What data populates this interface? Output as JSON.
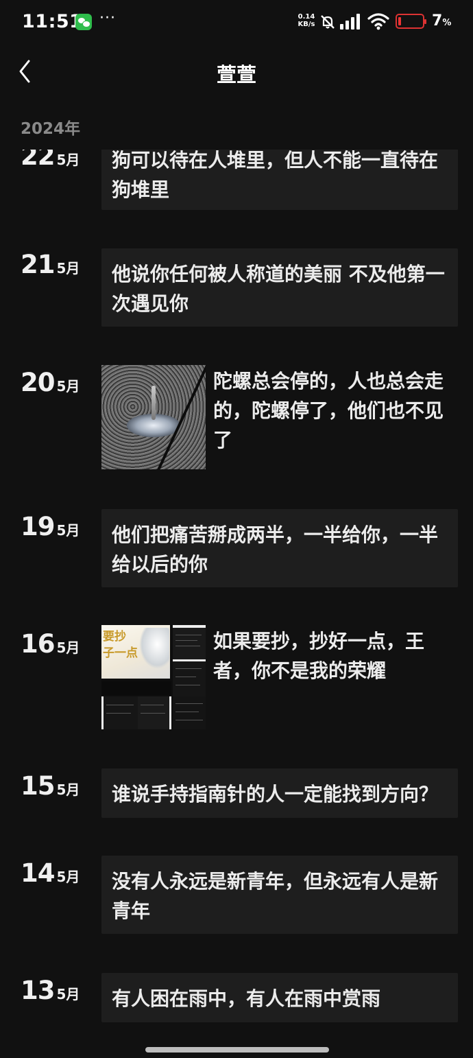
{
  "status_bar": {
    "time": "11:51",
    "dots": "···",
    "speed_value": "0.14",
    "speed_unit": "KB/s",
    "battery_pct": "7",
    "battery_unit": "%",
    "battery_color": "#dd3333",
    "wechat_color": "#2fbd4c"
  },
  "nav": {
    "title": "萱萱"
  },
  "year_header": "2024年",
  "entries": [
    {
      "day": "22",
      "month": "5月",
      "text": "狗可以待在人堆里，但人不能一直待在狗堆里"
    },
    {
      "day": "21",
      "month": "5月",
      "text": "他说你任何被人称道的美丽 不及他第一次遇见你"
    },
    {
      "day": "20",
      "month": "5月",
      "text": "陀螺总会停的，人也总会走的，陀螺停了，他们也不见了",
      "thumbnail": "spinning-top-photo"
    },
    {
      "day": "19",
      "month": "5月",
      "text": "他们把痛苦掰成两半，一半给你，一半给以后的你"
    },
    {
      "day": "16",
      "month": "5月",
      "text": "如果要抄，抄好一点，王者，你不是我的荣耀",
      "thumbnail": "screenshot-collage",
      "thumb_text_1": "要抄",
      "thumb_text_2": "子一点"
    },
    {
      "day": "15",
      "month": "5月",
      "text": "谁说手持指南针的人一定能找到方向？"
    },
    {
      "day": "14",
      "month": "5月",
      "text": "没有人永远是新青年，但永远有人是新青年"
    },
    {
      "day": "13",
      "month": "5月",
      "text": "有人困在雨中，有人在雨中赏雨"
    }
  ]
}
